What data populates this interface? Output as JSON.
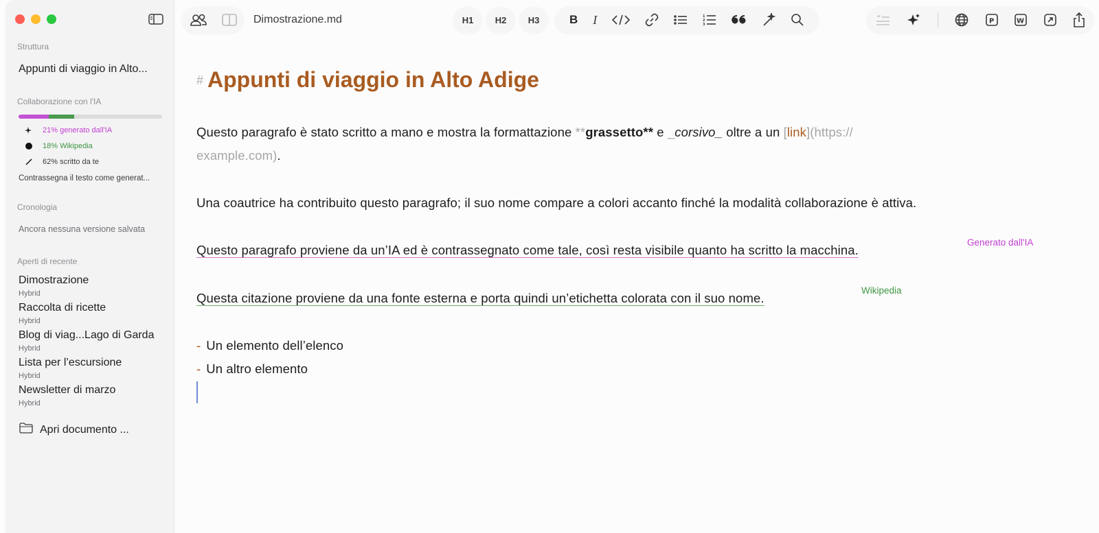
{
  "window": {
    "document_title": "Dimostrazione.md"
  },
  "sidebar": {
    "structure_label": "Struttura",
    "structure_item": "Appunti di viaggio in Alto...",
    "ai_section_label": "Collaborazione con l'IA",
    "ai_bar": {
      "ai_fraction": 0.21,
      "wiki_fraction": 0.18,
      "own_fraction": 0.62
    },
    "ai_legend": {
      "ai": "21% generato dall'IA",
      "wiki": "18% Wikipedia",
      "own": "62% scritto da te"
    },
    "mark_text_label": "Contrassegna il testo come generat...",
    "history_label": "Cronologia",
    "history_empty": "Ancora nessuna versione salvata",
    "recent_label": "Aperti di recente",
    "recent_items": [
      {
        "title": "Dimostrazione",
        "sub": "Hybrid"
      },
      {
        "title": "Raccolta di ricette",
        "sub": "Hybrid"
      },
      {
        "title": "Blog di viag...Lago di Garda",
        "sub": "Hybrid"
      },
      {
        "title": "Lista per l’escursione",
        "sub": "Hybrid"
      },
      {
        "title": "Newsletter di marzo",
        "sub": "Hybrid"
      }
    ],
    "open_document": "Apri documento ..."
  },
  "toolbar": {
    "h1": "H1",
    "h2": "H2",
    "h3": "H3",
    "icons": [
      "bold-icon",
      "italic-icon",
      "code-icon",
      "link-icon",
      "bulleted-list-icon",
      "numbered-list-icon",
      "quote-icon",
      "magic-wand-icon",
      "search-icon"
    ],
    "right_icons": [
      "quote-disabled-icon",
      "sparkle-icon",
      "globe-icon",
      "p-icon",
      "w-icon",
      "open-external-icon",
      "share-icon"
    ]
  },
  "editor": {
    "heading_hash": "#",
    "heading": "Appunti di viaggio in Alto Adige",
    "p1_a": "Questo paragrafo è stato scritto a mano e mostra la formattazione ",
    "p1_bold_open": "**",
    "p1_bold": "grassetto",
    "p1_bold_close": "**",
    "p1_e": " e ",
    "p1_it_open": "_",
    "p1_it": "corsivo",
    "p1_it_close": "_",
    "p1_b": " oltre a un ",
    "p1_lb": "[",
    "p1_link": "link",
    "p1_rb": "](",
    "p1_url1": "https://",
    "p1_url2": "example.com",
    "p1_close": ")",
    "p1_dot": ".",
    "p2": "Una coautrice ha contribuito questo paragrafo; il suo nome compare a colori accanto finché la modalità collaborazione è attiva.",
    "p3": "Questo paragrafo proviene da un’IA ed è contrassegnato come tale, così resta visibile quanto ha scritto la macchina.",
    "p3_tag": "Generato dall'IA",
    "p4": "Questa citazione proviene da una fonte esterna e porta quindi un’etichetta colorata con il suo nome.",
    "p4_tag": "Wikipedia",
    "bullet": "-",
    "list": [
      "Un elemento dell’elenco",
      "Un altro elemento"
    ]
  },
  "colors": {
    "accent": "#a95b21",
    "ai": "#c03fd0",
    "wiki": "#3d9642"
  }
}
